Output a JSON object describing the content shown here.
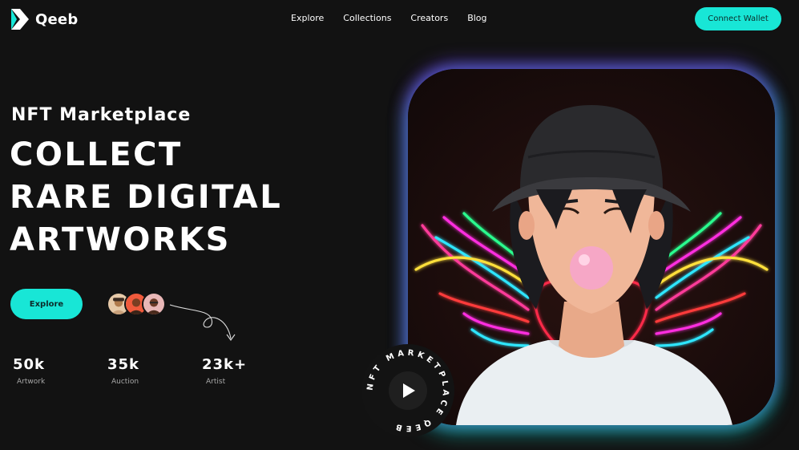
{
  "brand": {
    "name": "Qeeb",
    "icon": "qeeb-logo-icon"
  },
  "nav": {
    "items": [
      "Explore",
      "Collections",
      "Creators",
      "Blog"
    ]
  },
  "header": {
    "connect_label": "Connect Wallet"
  },
  "hero": {
    "eyebrow": "NFT Marketplace",
    "headline": [
      "COLLECT",
      "RARE DIGITAL",
      "ARTWORKS"
    ],
    "explore_label": "Explore"
  },
  "stats": [
    {
      "value": "50k",
      "label": "Artwork"
    },
    {
      "value": "35k",
      "label": "Auction"
    },
    {
      "value": "23k+",
      "label": "Artist"
    }
  ],
  "badge": {
    "ring_text": "NFT MARKETPLACE QEEB",
    "icon": "play-icon"
  },
  "colors": {
    "accent": "#18e6d6",
    "background": "#121212",
    "text": "#ffffff"
  }
}
